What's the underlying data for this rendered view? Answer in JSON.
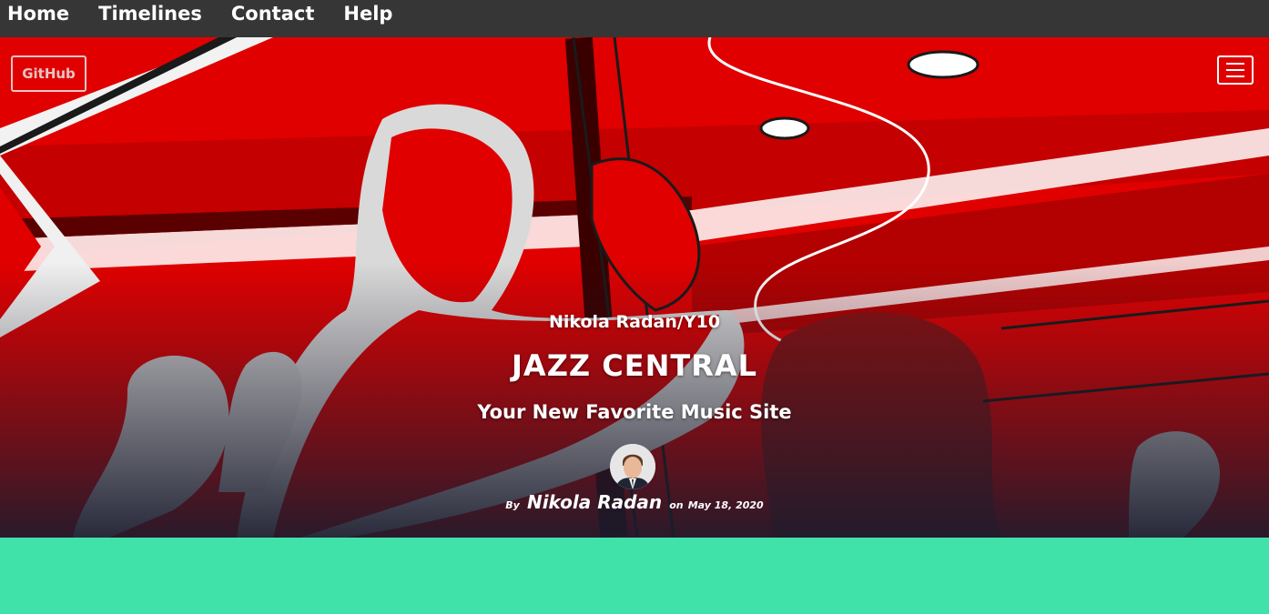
{
  "nav": {
    "items": [
      {
        "label": "Home"
      },
      {
        "label": "Timelines"
      },
      {
        "label": "Contact"
      },
      {
        "label": "Help"
      }
    ]
  },
  "hero": {
    "github_label": "GitHub",
    "menu_icon": "hamburger-menu-icon",
    "subtitle": "Nikola Radan/Y10",
    "title": "JAZZ CENTRAL",
    "tagline": "Your New Favorite Music Site",
    "byline": {
      "by": "By",
      "author": "Nikola Radan",
      "on": "on",
      "date": "May 18, 2020"
    }
  },
  "colors": {
    "nav_bg": "#363636",
    "hero_red": "#e00000",
    "footer_green": "#41e2a9"
  }
}
